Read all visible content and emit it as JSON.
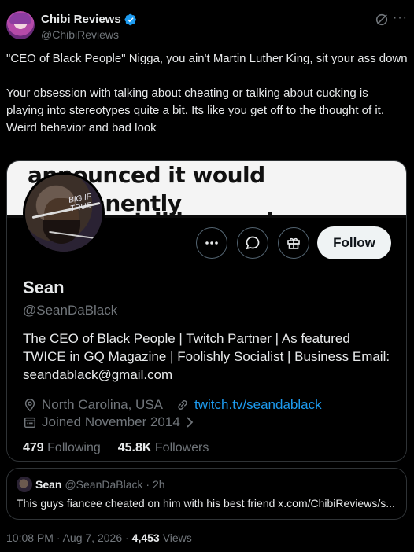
{
  "author": {
    "display_name": "Chibi Reviews",
    "handle": "@ChibiReviews",
    "verified_color": "#1d9bf0"
  },
  "post": {
    "paragraph1": "\"CEO of Black People\" Nigga, you ain't  Martin Luther King, sit your ass down",
    "paragraph2": "Your obsession with talking about cheating or talking about cucking is playing into stereotypes quite a bit. Its like you get off to the thought of it. Weird behavior and bad look"
  },
  "screenshot": {
    "banner_text": "announced it would permanently",
    "banner_text2": "replace striking workers",
    "avatar_scribble": "BIG IF TRUE",
    "follow_label": "Follow",
    "profile": {
      "name": "Sean",
      "handle": "@SeanDaBlack",
      "bio": "The CEO of Black People | Twitch Partner | As featured TWICE in GQ Magazine | Foolishly Socialist | Business Email: seandablack@gmail.com",
      "location": "North Carolina, USA",
      "website": "twitch.tv/seandablack",
      "joined": "Joined November 2014",
      "following_count": "479",
      "following_label": "Following",
      "followers_count": "45.8K",
      "followers_label": "Followers"
    }
  },
  "quote": {
    "name": "Sean",
    "handle_time": "@SeanDaBlack · 2h",
    "text": "This guys fiancee cheated on him with his best friend x.com/ChibiReviews/s..."
  },
  "meta": {
    "timestamp": "10:08 PM · Aug 7, 2026 ·",
    "views_count": "4,453",
    "views_label": "Views"
  },
  "colors": {
    "background": "#000000",
    "text": "#e7e9ea",
    "muted": "#71767b",
    "link": "#1d9bf0",
    "border": "#2f3336"
  },
  "icons": [
    "verified-badge-icon",
    "grok-icon",
    "more-icon",
    "ellipsis-icon",
    "message-icon",
    "gift-icon",
    "location-icon",
    "link-icon",
    "calendar-icon",
    "chevron-right-icon"
  ]
}
